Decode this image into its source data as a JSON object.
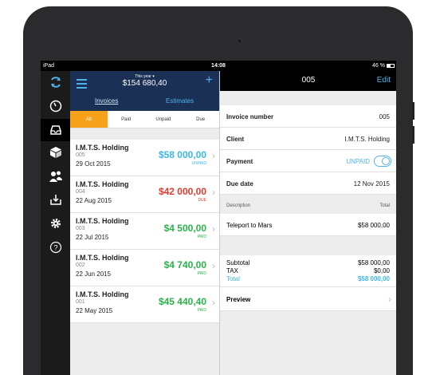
{
  "status_bar": {
    "carrier": "iPad",
    "time": "14:08",
    "battery": "46 %",
    "battery_level": 0.46
  },
  "colors": {
    "accent": "#4fb3ea",
    "navy": "#1a3054",
    "orange": "#f7a21b",
    "green": "#2ab34a",
    "red": "#e2392f"
  },
  "sidebar": {
    "items": [
      {
        "icon": "sync-icon"
      },
      {
        "icon": "speedometer-icon"
      },
      {
        "icon": "inbox-icon",
        "active": true
      },
      {
        "icon": "box-icon"
      },
      {
        "icon": "users-icon"
      },
      {
        "icon": "download-tray-icon"
      },
      {
        "icon": "gear-icon"
      },
      {
        "icon": "help-icon"
      }
    ]
  },
  "list_header": {
    "year_label": "This year ▾",
    "total": "$154 680,40",
    "tabs": [
      "Invoices",
      "Estimates"
    ]
  },
  "filters": [
    "All",
    "Paid",
    "Unpaid",
    "Due"
  ],
  "invoices": [
    {
      "client": "I.M.T.S. Holding",
      "number": "005",
      "date": "29 Oct 2015",
      "amount": "$58 000,00",
      "status": "UNPAID",
      "color": "#3ab7e6"
    },
    {
      "client": "I.M.T.S. Holding",
      "number": "004",
      "date": "22 Aug 2015",
      "amount": "$42 000,00",
      "status": "DUE",
      "color": "#e2392f"
    },
    {
      "client": "I.M.T.S. Holding",
      "number": "003",
      "date": "22 Jul 2015",
      "amount": "$4 500,00",
      "status": "PAID",
      "color": "#2ab34a"
    },
    {
      "client": "I.M.T.S. Holding",
      "number": "002",
      "date": "22 Jun 2015",
      "amount": "$4 740,00",
      "status": "PAID",
      "color": "#2ab34a"
    },
    {
      "client": "I.M.T.S. Holding",
      "number": "001",
      "date": "22 May 2015",
      "amount": "$45 440,40",
      "status": "PAID",
      "color": "#2ab34a"
    }
  ],
  "detail": {
    "title": "005",
    "edit_label": "Edit",
    "invoice_number_label": "Invoice number",
    "invoice_number": "005",
    "client_label": "Client",
    "client": "I.M.T.S. Holding",
    "payment_label": "Payment",
    "payment_status": "UNPAID",
    "due_date_label": "Due date",
    "due_date": "12 Nov 2015",
    "description_header": "Description",
    "total_header": "Total",
    "line_item": {
      "description": "Teleport to Mars",
      "total": "$58 000,00"
    },
    "subtotal_label": "Subtotal",
    "subtotal": "$58 000,00",
    "tax_label": "TAX",
    "tax": "$0,00",
    "total_label": "Total",
    "total": "$58 000,00",
    "preview_label": "Preview"
  }
}
